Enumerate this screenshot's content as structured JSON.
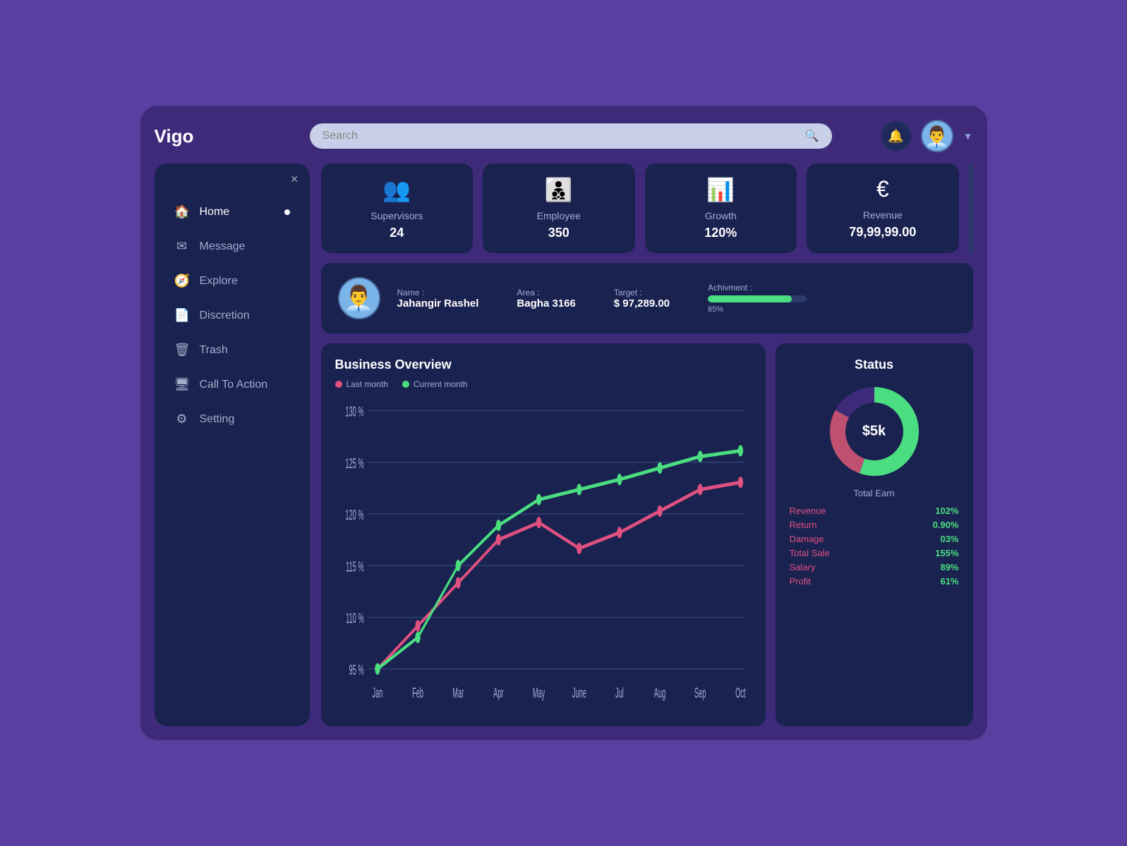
{
  "app": {
    "name": "Vigo"
  },
  "header": {
    "search_placeholder": "Search",
    "bell_icon": "bell",
    "dropdown_icon": "chevron-down"
  },
  "sidebar": {
    "close_label": "×",
    "items": [
      {
        "id": "home",
        "label": "Home",
        "icon": "🏠",
        "active": true,
        "dot": true
      },
      {
        "id": "message",
        "label": "Message",
        "icon": "✉",
        "active": false,
        "dot": false
      },
      {
        "id": "explore",
        "label": "Explore",
        "icon": "🧭",
        "active": false,
        "dot": false
      },
      {
        "id": "discreation",
        "label": "Discretion",
        "icon": "📄",
        "active": false,
        "dot": false
      },
      {
        "id": "trash",
        "label": "Trash",
        "icon": "🗑",
        "active": false,
        "dot": false
      },
      {
        "id": "call-to-action",
        "label": "Call To Action",
        "icon": "🖥",
        "active": false,
        "dot": false
      },
      {
        "id": "setting",
        "label": "Setting",
        "icon": "⚙",
        "active": false,
        "dot": false
      }
    ]
  },
  "stats": [
    {
      "id": "supervisors",
      "label": "Supervisors",
      "value": "24",
      "icon": "👥"
    },
    {
      "id": "employee",
      "label": "Employee",
      "value": "350",
      "icon": "👨‍👦‍👦"
    },
    {
      "id": "growth",
      "label": "Growth",
      "value": "120%",
      "icon": "📊"
    },
    {
      "id": "revenue",
      "label": "Revenue",
      "value": "79,99,99.00",
      "icon": "€"
    }
  ],
  "profile": {
    "name_label": "Name :",
    "name_value": "Jahangir Rashel",
    "area_label": "Area :",
    "area_value": "Bagha 3166",
    "target_label": "Target :",
    "target_value": "$ 97,289.00",
    "achievement_label": "Achivment :",
    "achievement_percent": 85
  },
  "business_overview": {
    "title": "Business Overview",
    "legend": [
      {
        "label": "Last month",
        "color": "#e05080"
      },
      {
        "label": "Current month",
        "color": "#4ade80"
      }
    ],
    "x_labels": [
      "Jan",
      "Feb",
      "Mar",
      "Apr",
      "May",
      "June",
      "Jul",
      "Aug",
      "Sep",
      "Oct"
    ],
    "y_labels": [
      "130 %",
      "125 %",
      "120 %",
      "115 %",
      "110 %",
      "95 %"
    ],
    "last_month": [
      0,
      8,
      18,
      28,
      32,
      28,
      30,
      35,
      42,
      46
    ],
    "current_month": [
      0,
      5,
      22,
      30,
      38,
      40,
      44,
      48,
      52,
      54
    ]
  },
  "status": {
    "title": "Status",
    "donut_value": "$5k",
    "total_earn_label": "Total Earn",
    "items": [
      {
        "label": "Revenue",
        "value": "102%",
        "color_label": "#e05080"
      },
      {
        "label": "Return",
        "value": "0.90%",
        "color_label": "#e05080"
      },
      {
        "label": "Damage",
        "value": "03%",
        "color_label": "#e05080"
      },
      {
        "label": "Total Sale",
        "value": "155%",
        "color_label": "#e05080"
      },
      {
        "label": "Salary",
        "value": "89%",
        "color_label": "#e05080"
      },
      {
        "label": "Profit",
        "value": "61%",
        "color_label": "#e05080"
      }
    ]
  }
}
